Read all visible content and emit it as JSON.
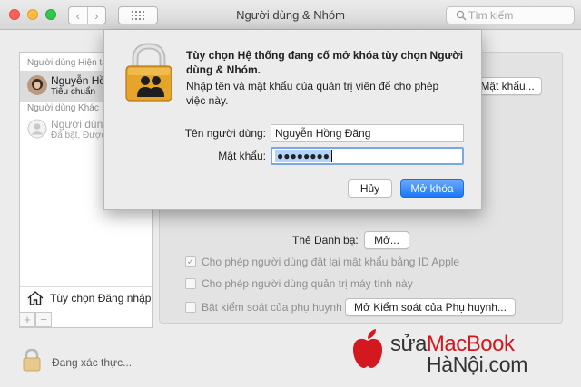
{
  "window": {
    "title": "Người dùng & Nhóm"
  },
  "toolbar": {
    "back": "‹",
    "forward": "›",
    "search_placeholder": "Tìm kiếm"
  },
  "sidebar": {
    "current_header": "Người dùng Hiện tại",
    "current_user": {
      "name": "Nguyễn Hồng Đăng",
      "role": "Tiêu chuẩn"
    },
    "other_header": "Người dùng Khác",
    "other_user": {
      "name": "Người dùng Khách",
      "status": "Đã bật, Được quản lý"
    },
    "login_options": "Tùy chọn Đăng nhập",
    "add": "+",
    "remove": "−"
  },
  "main": {
    "password_button": "Mật khẩu...",
    "contacts_label": "Thẻ Danh bạ:",
    "contacts_button": "Mở...",
    "allow_reset": "Cho phép người dùng đặt lại mật khẩu bằng ID Apple",
    "allow_admin": "Cho phép người dùng quản trị máy tính này",
    "enable_parental": "Bật kiểm soát của phụ huynh",
    "open_parental": "Mở Kiểm soát của Phụ huynh..."
  },
  "footer": {
    "auth_status": "Đang xác thực..."
  },
  "dialog": {
    "title": "Tùy chọn Hệ thống đang cố mở khóa tùy chọn Người dùng & Nhóm.",
    "message": "Nhập tên và mật khẩu của quản trị viên để cho phép việc này.",
    "username_label": "Tên người dùng:",
    "username_value": "Nguyễn Hồng Đăng",
    "password_label": "Mật khẩu:",
    "password_mask": "●●●●●●●●",
    "cancel": "Hủy",
    "unlock": "Mở khóa"
  },
  "watermark": {
    "part1": "sửa",
    "part2": "MacBook",
    "line2": "HàNội.com"
  },
  "colors": {
    "accent": "#1a78f6",
    "watermark_red": "#d4181f"
  }
}
